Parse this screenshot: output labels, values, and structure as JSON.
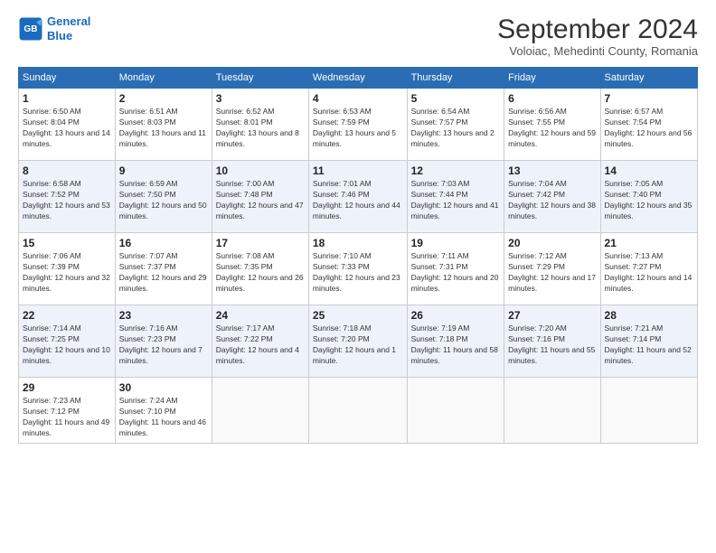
{
  "logo": {
    "line1": "General",
    "line2": "Blue"
  },
  "title": "September 2024",
  "subtitle": "Voloiac, Mehedinti County, Romania",
  "days_header": [
    "Sunday",
    "Monday",
    "Tuesday",
    "Wednesday",
    "Thursday",
    "Friday",
    "Saturday"
  ],
  "weeks": [
    [
      {
        "num": "1",
        "rise": "6:50 AM",
        "set": "8:04 PM",
        "daylight": "13 hours and 14 minutes."
      },
      {
        "num": "2",
        "rise": "6:51 AM",
        "set": "8:03 PM",
        "daylight": "13 hours and 11 minutes."
      },
      {
        "num": "3",
        "rise": "6:52 AM",
        "set": "8:01 PM",
        "daylight": "13 hours and 8 minutes."
      },
      {
        "num": "4",
        "rise": "6:53 AM",
        "set": "7:59 PM",
        "daylight": "13 hours and 5 minutes."
      },
      {
        "num": "5",
        "rise": "6:54 AM",
        "set": "7:57 PM",
        "daylight": "13 hours and 2 minutes."
      },
      {
        "num": "6",
        "rise": "6:56 AM",
        "set": "7:55 PM",
        "daylight": "12 hours and 59 minutes."
      },
      {
        "num": "7",
        "rise": "6:57 AM",
        "set": "7:54 PM",
        "daylight": "12 hours and 56 minutes."
      }
    ],
    [
      {
        "num": "8",
        "rise": "6:58 AM",
        "set": "7:52 PM",
        "daylight": "12 hours and 53 minutes."
      },
      {
        "num": "9",
        "rise": "6:59 AM",
        "set": "7:50 PM",
        "daylight": "12 hours and 50 minutes."
      },
      {
        "num": "10",
        "rise": "7:00 AM",
        "set": "7:48 PM",
        "daylight": "12 hours and 47 minutes."
      },
      {
        "num": "11",
        "rise": "7:01 AM",
        "set": "7:46 PM",
        "daylight": "12 hours and 44 minutes."
      },
      {
        "num": "12",
        "rise": "7:03 AM",
        "set": "7:44 PM",
        "daylight": "12 hours and 41 minutes."
      },
      {
        "num": "13",
        "rise": "7:04 AM",
        "set": "7:42 PM",
        "daylight": "12 hours and 38 minutes."
      },
      {
        "num": "14",
        "rise": "7:05 AM",
        "set": "7:40 PM",
        "daylight": "12 hours and 35 minutes."
      }
    ],
    [
      {
        "num": "15",
        "rise": "7:06 AM",
        "set": "7:39 PM",
        "daylight": "12 hours and 32 minutes."
      },
      {
        "num": "16",
        "rise": "7:07 AM",
        "set": "7:37 PM",
        "daylight": "12 hours and 29 minutes."
      },
      {
        "num": "17",
        "rise": "7:08 AM",
        "set": "7:35 PM",
        "daylight": "12 hours and 26 minutes."
      },
      {
        "num": "18",
        "rise": "7:10 AM",
        "set": "7:33 PM",
        "daylight": "12 hours and 23 minutes."
      },
      {
        "num": "19",
        "rise": "7:11 AM",
        "set": "7:31 PM",
        "daylight": "12 hours and 20 minutes."
      },
      {
        "num": "20",
        "rise": "7:12 AM",
        "set": "7:29 PM",
        "daylight": "12 hours and 17 minutes."
      },
      {
        "num": "21",
        "rise": "7:13 AM",
        "set": "7:27 PM",
        "daylight": "12 hours and 14 minutes."
      }
    ],
    [
      {
        "num": "22",
        "rise": "7:14 AM",
        "set": "7:25 PM",
        "daylight": "12 hours and 10 minutes."
      },
      {
        "num": "23",
        "rise": "7:16 AM",
        "set": "7:23 PM",
        "daylight": "12 hours and 7 minutes."
      },
      {
        "num": "24",
        "rise": "7:17 AM",
        "set": "7:22 PM",
        "daylight": "12 hours and 4 minutes."
      },
      {
        "num": "25",
        "rise": "7:18 AM",
        "set": "7:20 PM",
        "daylight": "12 hours and 1 minute."
      },
      {
        "num": "26",
        "rise": "7:19 AM",
        "set": "7:18 PM",
        "daylight": "11 hours and 58 minutes."
      },
      {
        "num": "27",
        "rise": "7:20 AM",
        "set": "7:16 PM",
        "daylight": "11 hours and 55 minutes."
      },
      {
        "num": "28",
        "rise": "7:21 AM",
        "set": "7:14 PM",
        "daylight": "11 hours and 52 minutes."
      }
    ],
    [
      {
        "num": "29",
        "rise": "7:23 AM",
        "set": "7:12 PM",
        "daylight": "11 hours and 49 minutes."
      },
      {
        "num": "30",
        "rise": "7:24 AM",
        "set": "7:10 PM",
        "daylight": "11 hours and 46 minutes."
      },
      null,
      null,
      null,
      null,
      null
    ]
  ],
  "labels": {
    "sunrise": "Sunrise:",
    "sunset": "Sunset:",
    "daylight": "Daylight:"
  }
}
